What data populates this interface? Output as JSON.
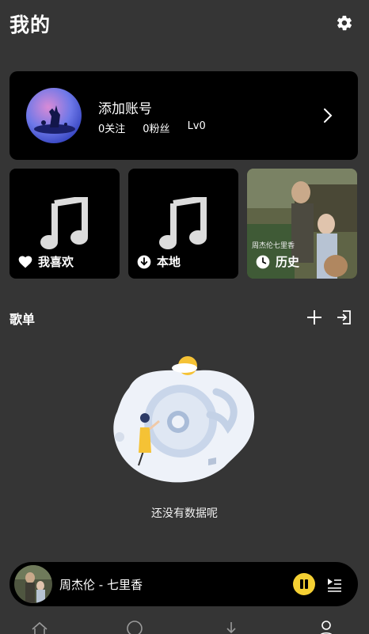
{
  "header": {
    "title": "我的"
  },
  "account": {
    "name": "添加账号",
    "follow": "0关注",
    "fans": "0粉丝",
    "level": "Lv0"
  },
  "tiles": [
    {
      "label": "我喜欢",
      "icon": "heart-icon"
    },
    {
      "label": "本地",
      "icon": "download-circle-icon"
    },
    {
      "label": "历史",
      "icon": "clock-icon"
    }
  ],
  "playlist": {
    "title": "歌单",
    "empty_text": "还没有数据呢"
  },
  "player": {
    "song": "周杰伦 - 七里香",
    "state": "playing"
  },
  "nav": [
    "home-icon",
    "discover-icon",
    "download-icon",
    "profile-icon"
  ],
  "colors": {
    "accent": "#f5d033",
    "background": "#353535",
    "card": "#000000"
  }
}
